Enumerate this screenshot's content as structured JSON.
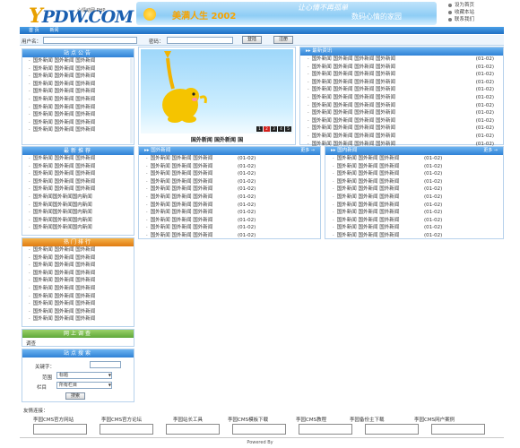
{
  "header": {
    "logo": "YPDW.COM",
    "tagline": "心情动网 PHP",
    "banner_main": "美满人生 2002",
    "banner_small1": "让心情不再孤单",
    "banner_small2": "数码心情的家园",
    "links": [
      "设为首页",
      "收藏本站",
      "联系我们"
    ]
  },
  "nav": {
    "items": [
      "首 页",
      "新闻"
    ]
  },
  "login": {
    "user_label": "用户名：",
    "pass_label": "密码：",
    "login_button": "登陆",
    "register_button": "注册"
  },
  "left": {
    "announcement": {
      "title": "站点公告",
      "items": [
        "国外新闻 国外新闻 国外新闻",
        "国外新闻 国外新闻 国外新闻",
        "国外新闻 国外新闻 国外新闻",
        "国外新闻 国外新闻 国外新闻",
        "国外新闻 国外新闻 国外新闻",
        "国外新闻 国外新闻 国外新闻",
        "国外新闻 国外新闻 国外新闻",
        "国外新闻 国外新闻 国外新闻",
        "国外新闻 国外新闻 国外新闻",
        "国外新闻 国外新闻 国外新闻"
      ]
    },
    "recommend": {
      "title": "最新推荐",
      "items": [
        "国外新闻 国外新闻 国外新闻",
        "国外新闻 国外新闻 国外新闻",
        "国外新闻 国外新闻 国外新闻",
        "国外新闻 国外新闻 国外新闻",
        "国外新闻 国外新闻 国外新闻",
        "国外新闻国外新闻国内新闻",
        "国外新闻国外新闻国内新闻",
        "国外新闻国外新闻国内新闻",
        "国外新闻国外新闻国内新闻",
        "国外新闻国外新闻国内新闻"
      ]
    },
    "hot": {
      "title": "热门排行",
      "items": [
        "国外新闻 国外新闻 国外新闻",
        "国外新闻 国外新闻 国外新闻",
        "国外新闻 国外新闻 国外新闻",
        "国外新闻 国外新闻 国外新闻",
        "国外新闻 国外新闻 国外新闻",
        "国外新闻 国外新闻 国外新闻",
        "国外新闻 国外新闻 国外新闻",
        "国外新闻 国外新闻 国外新闻",
        "国外新闻 国外新闻 国外新闻",
        "国外新闻 国外新闻 国外新闻"
      ]
    },
    "survey": {
      "title": "网上调查",
      "content": "调查"
    },
    "search": {
      "title": "站点搜索",
      "keyword_label": "关键字：",
      "scope_label": "范围",
      "scope_value": "标题",
      "column_label": "栏目",
      "column_value": "所有栏目",
      "search_button": "搜索"
    }
  },
  "slide": {
    "caption": "国外新闻 国外新闻 国",
    "pages": [
      "1",
      "2",
      "3",
      "4",
      "5"
    ]
  },
  "latest": {
    "title": "最新资讯",
    "items": [
      {
        "t": "国外新闻 国外新闻 国外新闻 国外新闻",
        "d": "(01-02)"
      },
      {
        "t": "国外新闻 国外新闻 国外新闻 国外新闻",
        "d": "(01-02)"
      },
      {
        "t": "国外新闻 国外新闻 国外新闻 国外新闻",
        "d": "(01-02)"
      },
      {
        "t": "国外新闻 国外新闻 国外新闻 国外新闻",
        "d": "(01-02)"
      },
      {
        "t": "国外新闻 国外新闻 国外新闻 国外新闻",
        "d": "(01-02)"
      },
      {
        "t": "国外新闻 国外新闻 国外新闻 国外新闻",
        "d": "(01-02)"
      },
      {
        "t": "国外新闻 国外新闻 国外新闻 国外新闻",
        "d": "(01-02)"
      },
      {
        "t": "国外新闻 国外新闻 国外新闻 国外新闻",
        "d": "(01-02)"
      },
      {
        "t": "国外新闻 国外新闻 国外新闻 国外新闻",
        "d": "(01-02)"
      },
      {
        "t": "国外新闻 国外新闻 国外新闻 国外新闻",
        "d": "(01-02)"
      },
      {
        "t": "国外新闻 国外新闻 国外新闻 国外新闻",
        "d": "(01-02)"
      },
      {
        "t": "国外新闻 国外新闻 国外新闻 国外新闻",
        "d": "(01-02)"
      }
    ]
  },
  "foreign": {
    "title": "国外新闻",
    "more": "更多 →",
    "items": [
      {
        "t": "国外新闻 国外新闻 国外新闻",
        "d": "(01-02)"
      },
      {
        "t": "国外新闻 国外新闻 国外新闻",
        "d": "(01-02)"
      },
      {
        "t": "国外新闻 国外新闻 国外新闻",
        "d": "(01-02)"
      },
      {
        "t": "国外新闻 国外新闻 国外新闻",
        "d": "(01-02)"
      },
      {
        "t": "国外新闻 国外新闻 国外新闻",
        "d": "(01-02)"
      },
      {
        "t": "国外新闻 国外新闻 国外新闻",
        "d": "(01-02)"
      },
      {
        "t": "国外新闻 国外新闻 国外新闻",
        "d": "(01-02)"
      },
      {
        "t": "国外新闻 国外新闻 国外新闻",
        "d": "(01-02)"
      },
      {
        "t": "国外新闻 国外新闻 国外新闻",
        "d": "(01-02)"
      },
      {
        "t": "国外新闻 国外新闻 国外新闻",
        "d": "(01-02)"
      },
      {
        "t": "国外新闻 国外新闻 国外新闻",
        "d": "(01-02)"
      }
    ]
  },
  "domestic": {
    "title": "国内新闻",
    "more": "更多 →",
    "items": [
      {
        "t": "国外新闻 国外新闻 国外新闻",
        "d": "(01-02)"
      },
      {
        "t": "国外新闻 国外新闻 国外新闻",
        "d": "(01-02)"
      },
      {
        "t": "国外新闻 国外新闻 国外新闻",
        "d": "(01-02)"
      },
      {
        "t": "国外新闻 国外新闻 国外新闻",
        "d": "(01-02)"
      },
      {
        "t": "国外新闻 国外新闻 国外新闻",
        "d": "(01-02)"
      },
      {
        "t": "国外新闻 国外新闻 国外新闻",
        "d": "(01-02)"
      },
      {
        "t": "国外新闻 国外新闻 国外新闻",
        "d": "(01-02)"
      },
      {
        "t": "国外新闻 国外新闻 国外新闻",
        "d": "(01-02)"
      },
      {
        "t": "国外新闻 国外新闻 国外新闻",
        "d": "(01-02)"
      },
      {
        "t": "国外新闻 国外新闻 国外新闻",
        "d": "(01-02)"
      },
      {
        "t": "国外新闻 国外新闻 国外新闻",
        "d": "(01-02)"
      }
    ]
  },
  "friends": {
    "title": "友情连接：",
    "links": [
      "李园CMS官方网站",
      "李园CMS官方论坛",
      "李园站长工具",
      "李园CMS模板下载",
      "李园CMS教程",
      "李园备份主下载",
      "李园CMS网户案例"
    ]
  },
  "footer": {
    "powered": "Powered By"
  },
  "colors": {
    "accent_blue": "#2f82d6",
    "accent_orange": "#e07a10",
    "accent_green": "#5fa83a",
    "border": "#b7d2ec"
  }
}
